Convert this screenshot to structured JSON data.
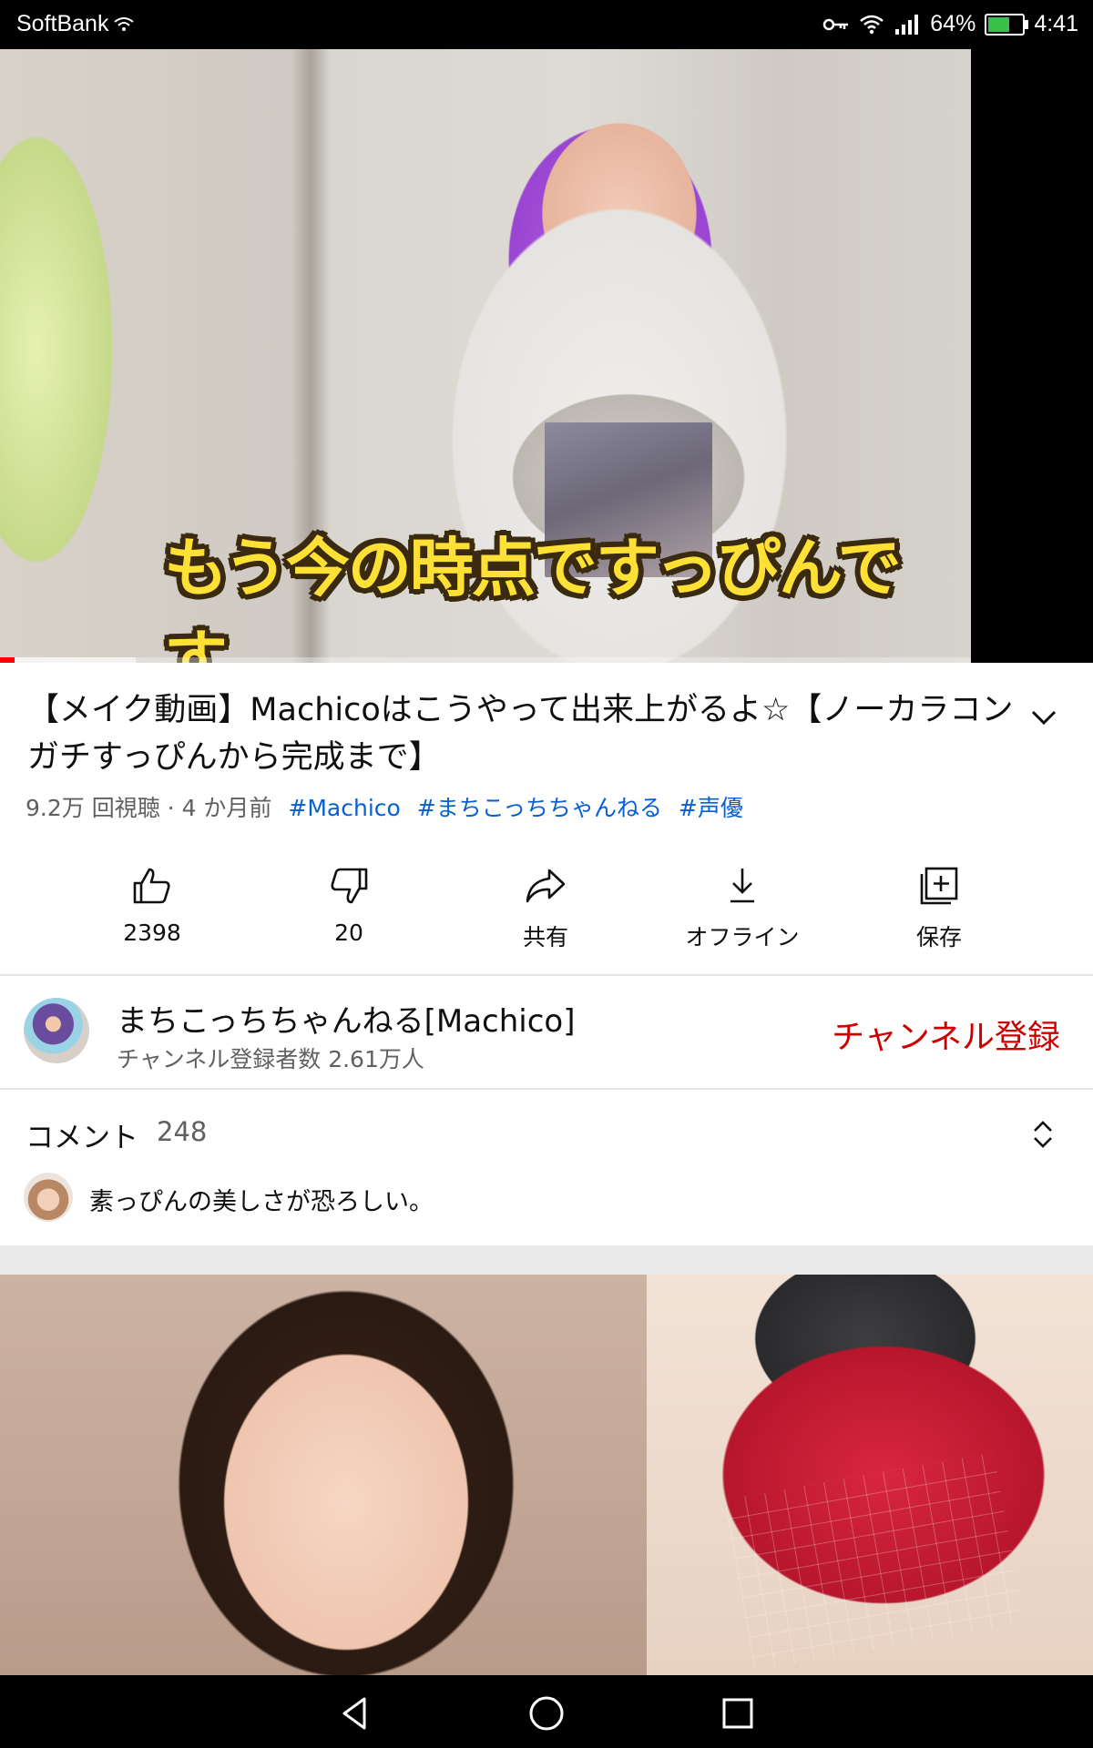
{
  "status_bar": {
    "carrier": "SoftBank",
    "battery_percent": "64%",
    "battery_level": 0.64,
    "time": "4:41"
  },
  "player": {
    "caption": "もう今の時点ですっぴんです",
    "progress_played": 0.015,
    "progress_buffered": 0.14
  },
  "video": {
    "title": "【メイク動画】Machicoはこうやって出来上がるよ☆【ノーカラコンガチすっぴんから完成まで】",
    "views": "9.2万 回視聴",
    "age": "4 か月前",
    "hashtags": [
      "#Machico",
      "#まちこっちちゃんねる",
      "#声優"
    ]
  },
  "actions": {
    "like": "2398",
    "dislike": "20",
    "share": "共有",
    "offline": "オフライン",
    "save": "保存"
  },
  "channel": {
    "name": "まちこっちちゃんねる[Machico]",
    "subscribers": "チャンネル登録者数 2.61万人",
    "subscribe_label": "チャンネル登録"
  },
  "comments": {
    "label": "コメント",
    "count": "248",
    "top_comment": "素っぴんの美しさが恐ろしい。"
  },
  "colors": {
    "accent_red": "#cc0000",
    "hashtag_blue": "#065fd4",
    "caption_yellow": "#ffe135"
  },
  "icons": {
    "like": "thumbs-up-icon",
    "dislike": "thumbs-down-icon",
    "share": "share-arrow-icon",
    "offline": "download-icon",
    "save": "playlist-add-icon"
  }
}
